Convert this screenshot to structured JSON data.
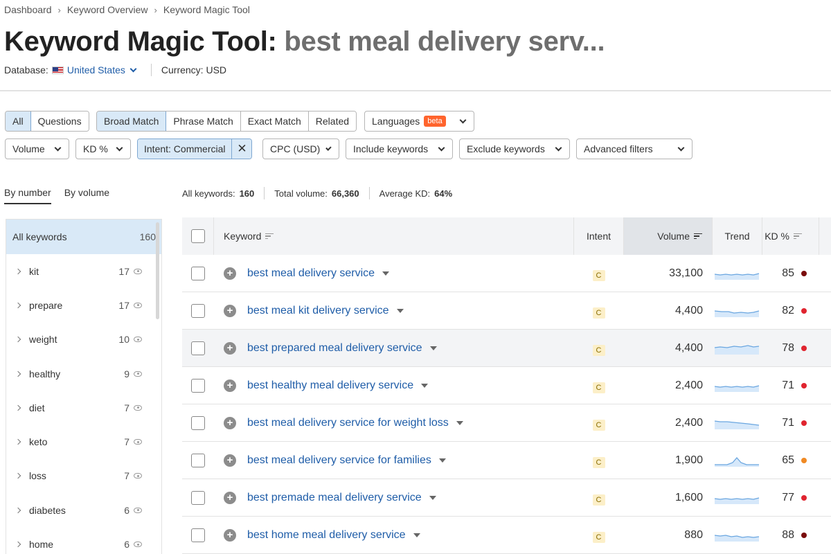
{
  "breadcrumb": [
    "Dashboard",
    "Keyword Overview",
    "Keyword Magic Tool"
  ],
  "title": {
    "tool": "Keyword Magic Tool:",
    "query": "best meal delivery serv..."
  },
  "meta": {
    "database_label": "Database:",
    "database_value": "United States",
    "currency_label": "Currency: USD"
  },
  "match_tabs": [
    {
      "label": "All",
      "active": true
    },
    {
      "label": "Questions",
      "active": false
    }
  ],
  "match_types": [
    {
      "label": "Broad Match",
      "active": true
    },
    {
      "label": "Phrase Match",
      "active": false
    },
    {
      "label": "Exact Match",
      "active": false
    },
    {
      "label": "Related",
      "active": false
    }
  ],
  "languages": {
    "label": "Languages",
    "badge": "beta"
  },
  "filters": {
    "volume": "Volume",
    "kd": "KD %",
    "intent_chip": "Intent: Commercial",
    "cpc": "CPC (USD)",
    "include": "Include keywords",
    "exclude": "Exclude keywords",
    "advanced": "Advanced filters"
  },
  "side_tabs": {
    "by_number": "By number",
    "by_volume": "By volume"
  },
  "summary": {
    "all_keywords_label": "All keywords:",
    "all_keywords_value": "160",
    "total_volume_label": "Total volume:",
    "total_volume_value": "66,360",
    "avg_kd_label": "Average KD:",
    "avg_kd_value": "64%"
  },
  "groups": {
    "all": {
      "name": "All keywords",
      "count": "160"
    },
    "items": [
      {
        "name": "kit",
        "count": "17"
      },
      {
        "name": "prepare",
        "count": "17"
      },
      {
        "name": "weight",
        "count": "10"
      },
      {
        "name": "healthy",
        "count": "9"
      },
      {
        "name": "diet",
        "count": "7"
      },
      {
        "name": "keto",
        "count": "7"
      },
      {
        "name": "loss",
        "count": "7"
      },
      {
        "name": "diabetes",
        "count": "6"
      },
      {
        "name": "home",
        "count": "6"
      }
    ]
  },
  "table": {
    "headers": {
      "keyword": "Keyword",
      "intent": "Intent",
      "volume": "Volume",
      "trend": "Trend",
      "kd": "KD %"
    },
    "rows": [
      {
        "keyword": "best meal delivery service",
        "intent": "C",
        "volume": "33,100",
        "kd": "85",
        "kd_color": "#7a0b0b",
        "trend": "flat"
      },
      {
        "keyword": "best meal kit delivery service",
        "intent": "C",
        "volume": "4,400",
        "kd": "82",
        "kd_color": "#e0242f",
        "trend": "dip"
      },
      {
        "keyword": "best prepared meal delivery service",
        "intent": "C",
        "volume": "4,400",
        "kd": "78",
        "kd_color": "#e0242f",
        "trend": "bump"
      },
      {
        "keyword": "best healthy meal delivery service",
        "intent": "C",
        "volume": "2,400",
        "kd": "71",
        "kd_color": "#e0242f",
        "trend": "flat"
      },
      {
        "keyword": "best meal delivery service for weight loss",
        "intent": "C",
        "volume": "2,400",
        "kd": "71",
        "kd_color": "#e0242f",
        "trend": "drop"
      },
      {
        "keyword": "best meal delivery service for families",
        "intent": "C",
        "volume": "1,900",
        "kd": "65",
        "kd_color": "#f08a24",
        "trend": "peak"
      },
      {
        "keyword": "best premade meal delivery service",
        "intent": "C",
        "volume": "1,600",
        "kd": "77",
        "kd_color": "#e0242f",
        "trend": "flat"
      },
      {
        "keyword": "best home meal delivery service",
        "intent": "C",
        "volume": "880",
        "kd": "88",
        "kd_color": "#7a0b0b",
        "trend": "wave"
      }
    ]
  },
  "colors": {
    "accent": "#1f5da8",
    "active_bg": "#d9e9f7",
    "beta": "#ff642d",
    "intent_bg": "#fcefc8"
  }
}
